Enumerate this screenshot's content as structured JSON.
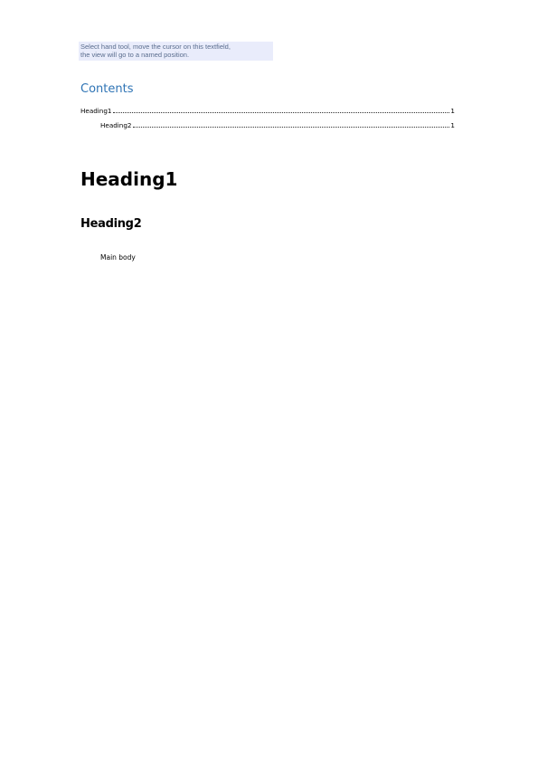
{
  "textfield": {
    "line1": "Select hand tool, move the cursor on this textfield,",
    "line2": "the view will go to a named position."
  },
  "toc": {
    "title": "Contents",
    "entries": [
      {
        "label": "Heading1",
        "page": "1"
      },
      {
        "label": "Heading2",
        "page": "1"
      }
    ]
  },
  "document": {
    "heading1": "Heading1",
    "heading2": "Heading2",
    "body": "Main body"
  },
  "colors": {
    "toc_title": "#2f74b5",
    "textfield_bg": "#e9ecfb",
    "textfield_text": "#5a6d8e"
  }
}
